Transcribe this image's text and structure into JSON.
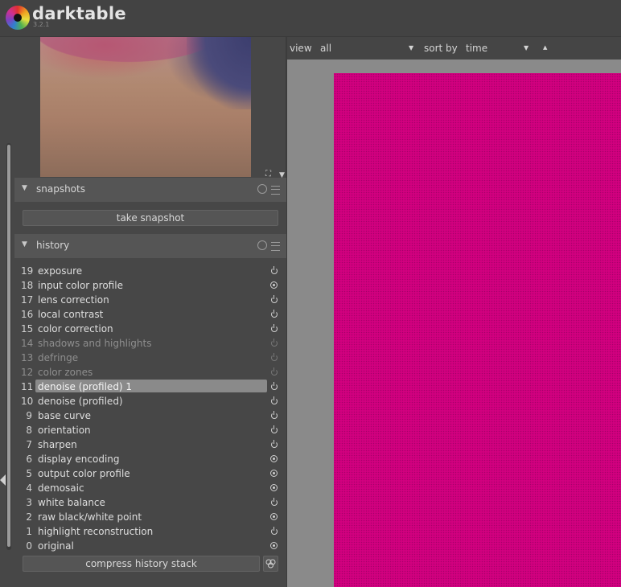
{
  "app": {
    "name": "darktable",
    "version": "3.2.1"
  },
  "toolbar": {
    "view_label": "view",
    "view_value": "all",
    "sort_label": "sort by",
    "sort_value": "time",
    "sort_order_icon": "arrow-up-icon"
  },
  "snapshots": {
    "title": "snapshots",
    "take_snapshot_label": "take snapshot"
  },
  "history": {
    "title": "history",
    "items": [
      {
        "num": "19",
        "label": "exposure",
        "state": "on",
        "icon": "power-icon"
      },
      {
        "num": "18",
        "label": "input color profile",
        "state": "always",
        "icon": "always-on-icon"
      },
      {
        "num": "17",
        "label": "lens correction",
        "state": "on",
        "icon": "power-icon"
      },
      {
        "num": "16",
        "label": "local contrast",
        "state": "on",
        "icon": "power-icon"
      },
      {
        "num": "15",
        "label": "color correction",
        "state": "on",
        "icon": "power-icon"
      },
      {
        "num": "14",
        "label": "shadows and highlights",
        "state": "off",
        "icon": "power-icon"
      },
      {
        "num": "13",
        "label": "defringe",
        "state": "off",
        "icon": "power-icon"
      },
      {
        "num": "12",
        "label": "color zones",
        "state": "off",
        "icon": "power-icon"
      },
      {
        "num": "11",
        "label": "denoise (profiled) 1",
        "state": "on",
        "icon": "power-icon",
        "selected": true
      },
      {
        "num": "10",
        "label": "denoise (profiled)",
        "state": "on",
        "icon": "power-icon"
      },
      {
        "num": "9",
        "label": "base curve",
        "state": "on",
        "icon": "power-icon"
      },
      {
        "num": "8",
        "label": "orientation",
        "state": "on",
        "icon": "power-icon"
      },
      {
        "num": "7",
        "label": "sharpen",
        "state": "on",
        "icon": "power-icon"
      },
      {
        "num": "6",
        "label": "display encoding",
        "state": "always",
        "icon": "always-on-icon"
      },
      {
        "num": "5",
        "label": "output color profile",
        "state": "always",
        "icon": "always-on-icon"
      },
      {
        "num": "4",
        "label": "demosaic",
        "state": "always",
        "icon": "always-on-icon"
      },
      {
        "num": "3",
        "label": "white balance",
        "state": "on",
        "icon": "power-icon"
      },
      {
        "num": "2",
        "label": "raw black/white point",
        "state": "always",
        "icon": "always-on-icon"
      },
      {
        "num": "1",
        "label": "highlight reconstruction",
        "state": "on",
        "icon": "power-icon"
      },
      {
        "num": "0",
        "label": "original",
        "state": "always",
        "icon": "always-on-icon"
      }
    ],
    "compress_label": "compress history stack"
  },
  "colors": {
    "image_fill": "#d2007f",
    "panel_bg": "#474747",
    "selected_row": "#8a8a8a"
  }
}
